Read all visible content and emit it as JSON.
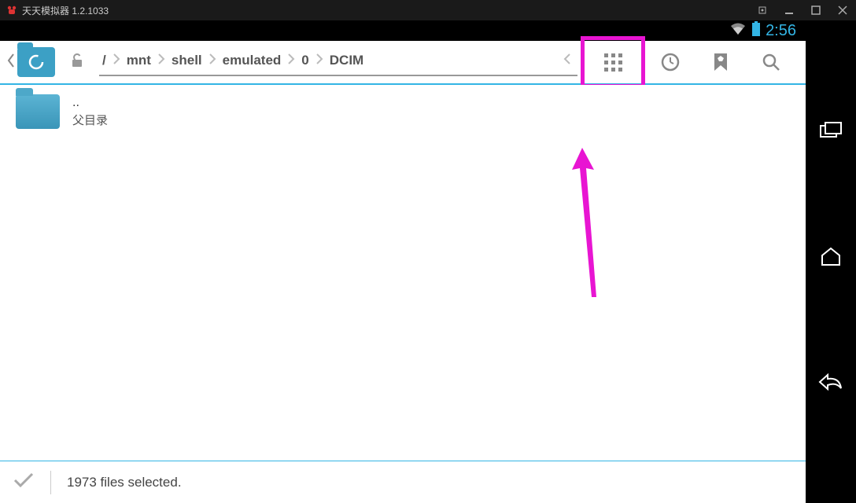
{
  "window": {
    "title": "天天模拟器 1.2.1033"
  },
  "status_bar": {
    "time": "2:56"
  },
  "breadcrumb": {
    "root": "/",
    "items": [
      "mnt",
      "shell",
      "emulated",
      "0",
      "DCIM"
    ]
  },
  "file_list": {
    "parent_dir": {
      "name": "..",
      "label": "父目录"
    }
  },
  "footer": {
    "status_text": "1973 files selected."
  }
}
